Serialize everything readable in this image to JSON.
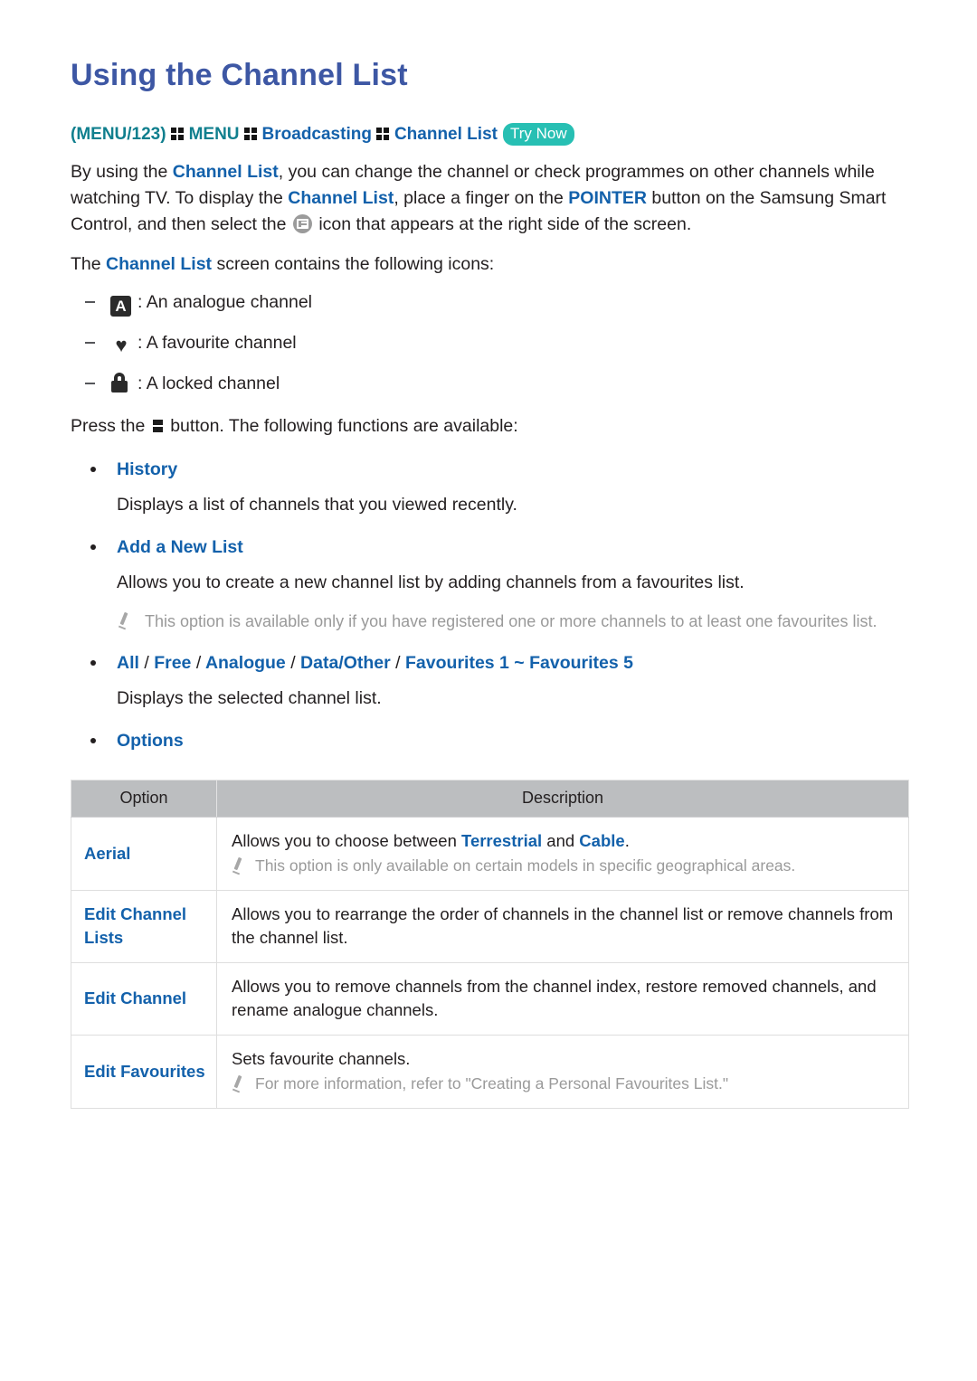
{
  "colors": {
    "heading": "#3d57a4",
    "link_blue": "#1361ab",
    "teal": "#107f8e",
    "badge_teal": "#27bfb3",
    "table_header_bg": "#bcbec0",
    "note_gray": "#9a9a9a"
  },
  "header": {
    "title": "Using the Channel List"
  },
  "breadcrumb": {
    "open_paren": "(",
    "menu123": "MENU/123",
    "close_paren": ")",
    "menu": "MENU",
    "broadcasting": "Broadcasting",
    "channel_list": "Channel List",
    "try_now": "Try Now",
    "grid_icon_name": "menu-grid-icon"
  },
  "intro": {
    "p1_part1": "By using the ",
    "p1_link1": "Channel List",
    "p1_part2": ", you can change the channel or check programmes on other channels while watching TV. To display the ",
    "p1_link2": "Channel List",
    "p1_part3": ", place a finger on the ",
    "p1_pointer": "POINTER",
    "p1_part4": " button on the Samsung Smart Control, and then select the ",
    "p1_icon_name": "channel-list-tv-icon",
    "p1_part5": " icon that appears at the right side of the screen.",
    "p2_part1": "The ",
    "p2_link1": "Channel List",
    "p2_part2": " screen contains the following icons:"
  },
  "legend": [
    {
      "icon": "analogue-channel-icon",
      "icon_label": "A",
      "text": ": An analogue channel"
    },
    {
      "icon": "favourite-heart-icon",
      "icon_label": "♥",
      "text": ": A favourite channel"
    },
    {
      "icon": "locked-padlock-icon",
      "icon_label": "",
      "text": ": A locked channel"
    }
  ],
  "press_line": {
    "part1": "Press the ",
    "glyph_name": "more-options-button-glyph",
    "part2": " button. The following functions are available:"
  },
  "sections": [
    {
      "title": "History",
      "desc": "Displays a list of channels that you viewed recently."
    },
    {
      "title": "Add a New List",
      "desc": "Allows you to create a new channel list by adding channels from a favourites list.",
      "note": "This option is available only if you have registered one or more channels to at least one favourites list."
    }
  ],
  "channel_list_options": {
    "items": [
      "All",
      "Free",
      "Analogue",
      "Data/Other",
      "Favourites 1 ~ Favourites 5"
    ],
    "separator": "/",
    "desc": "Displays the selected channel list."
  },
  "options_section": {
    "title": "Options"
  },
  "table": {
    "columns": [
      "Option",
      "Description"
    ],
    "rows": [
      {
        "option": "Aerial",
        "desc_pre": "Allows you to choose between ",
        "desc_link1": "Terrestrial",
        "desc_mid": " and ",
        "desc_link2": "Cable",
        "desc_post": ".",
        "note": "This option is only available on certain models in specific geographical areas."
      },
      {
        "option": "Edit Channel Lists",
        "desc": "Allows you to rearrange the order of channels in the channel list or remove channels from the channel list.",
        "note": ""
      },
      {
        "option": "Edit Channel",
        "desc": "Allows you to remove channels from the channel index, restore removed channels, and rename analogue channels.",
        "note": ""
      },
      {
        "option": "Edit Favourites",
        "desc": "Sets favourite channels.",
        "note": "For more information, refer to \"Creating a Personal Favourites List.\""
      }
    ]
  }
}
